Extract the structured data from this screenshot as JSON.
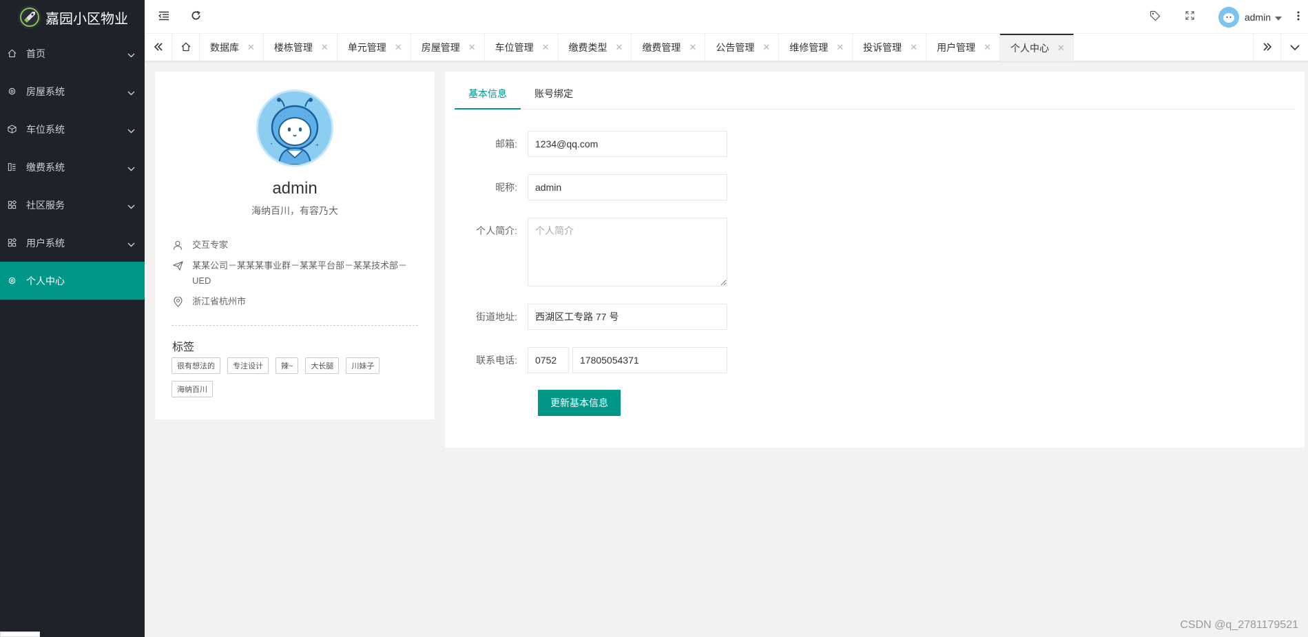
{
  "app": {
    "title": "嘉园小区物业"
  },
  "sidebar": {
    "items": [
      {
        "label": "首页",
        "icon": "home-icon"
      },
      {
        "label": "房屋系统",
        "icon": "gear-icon"
      },
      {
        "label": "车位系统",
        "icon": "cube-icon"
      },
      {
        "label": "缴费系统",
        "icon": "ledger-icon"
      },
      {
        "label": "社区服务",
        "icon": "apps-icon"
      },
      {
        "label": "用户系统",
        "icon": "apps-icon"
      },
      {
        "label": "个人中心",
        "icon": "gear-icon"
      }
    ]
  },
  "header": {
    "username": "admin"
  },
  "tabs": [
    {
      "label": "数据库"
    },
    {
      "label": "楼栋管理"
    },
    {
      "label": "单元管理"
    },
    {
      "label": "房屋管理"
    },
    {
      "label": "车位管理"
    },
    {
      "label": "缴费类型"
    },
    {
      "label": "缴费管理"
    },
    {
      "label": "公告管理"
    },
    {
      "label": "维修管理"
    },
    {
      "label": "投诉管理"
    },
    {
      "label": "用户管理"
    },
    {
      "label": "个人中心"
    }
  ],
  "profile": {
    "name": "admin",
    "motto": "海纳百川，有容乃大",
    "title": "交互专家",
    "department": "某某公司－某某某事业群－某某平台部－某某技术部－UED",
    "location": "浙江省杭州市",
    "tags_title": "标签",
    "tags": [
      "很有想法的",
      "专注设计",
      "辣~",
      "大长腿",
      "川妹子",
      "海纳百川"
    ]
  },
  "form": {
    "tabs": [
      "基本信息",
      "账号绑定"
    ],
    "email_label": "邮箱:",
    "email_value": "1234@qq.com",
    "nickname_label": "昵称:",
    "nickname_value": "admin",
    "bio_label": "个人简介:",
    "bio_placeholder": "个人简介",
    "address_label": "街道地址:",
    "address_value": "西湖区工专路 77 号",
    "phone_label": "联系电话:",
    "phone_area": "0752",
    "phone_number": "17805054371",
    "submit_label": "更新基本信息"
  },
  "watermark": "CSDN @q_2781179521",
  "colors": {
    "sidebar_bg": "#20222a",
    "accent": "#009688"
  }
}
